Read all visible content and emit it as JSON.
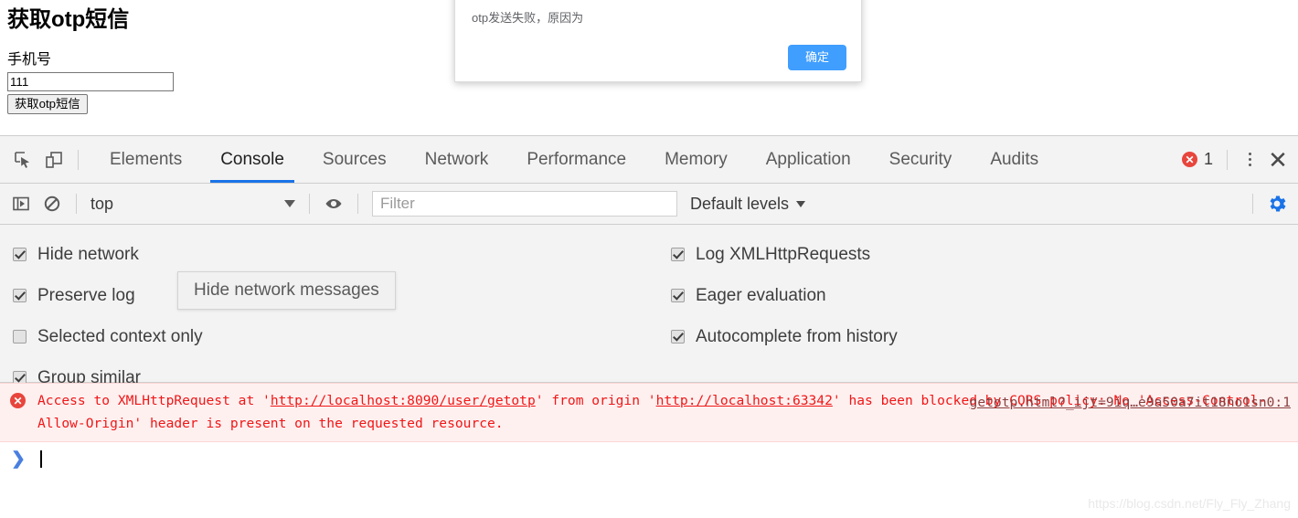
{
  "page": {
    "title": "获取otp短信",
    "phone_label": "手机号",
    "phone_value": "111",
    "phone_placeholder": "",
    "submit_button": "获取otp短信"
  },
  "dialog": {
    "message": "otp发送失败，原因为",
    "confirm_button": "确定",
    "confirm_color": "#409eff"
  },
  "devtools": {
    "tabs": [
      {
        "label": "Elements",
        "active": false
      },
      {
        "label": "Console",
        "active": true
      },
      {
        "label": "Sources",
        "active": false
      },
      {
        "label": "Network",
        "active": false
      },
      {
        "label": "Performance",
        "active": false
      },
      {
        "label": "Memory",
        "active": false
      },
      {
        "label": "Application",
        "active": false
      },
      {
        "label": "Security",
        "active": false
      },
      {
        "label": "Audits",
        "active": false
      }
    ],
    "active_tab": "Console",
    "error_badge": {
      "glyph": "✕",
      "count": "1",
      "color": "#e8453c"
    },
    "close_glyph": "✕",
    "toolbar": {
      "context_value": "top",
      "filter_placeholder": "Filter",
      "filter_value": "",
      "levels_value": "Default levels",
      "settings_active_color": "#1a73e8"
    },
    "settings": {
      "left": [
        {
          "label": "Hide network",
          "checked": true
        },
        {
          "label": "Preserve log",
          "checked": true
        },
        {
          "label": "Selected context only",
          "checked": false
        },
        {
          "label": "Group similar",
          "checked": true
        }
      ],
      "right": [
        {
          "label": "Log XMLHttpRequests",
          "checked": true
        },
        {
          "label": "Eager evaluation",
          "checked": true
        },
        {
          "label": "Autocomplete from history",
          "checked": true
        }
      ],
      "tooltip": "Hide network messages"
    },
    "console": {
      "error": {
        "icon_glyph": "✕",
        "seg_1": "Access to XMLHttpRequest at ",
        "seg_2": "'",
        "url_1": "http://localhost:8090/user/getotp",
        "seg_3": "' from origin ",
        "seg_4": "'",
        "url_2": "http://localhost:63342",
        "seg_5": "' has been blocked by CORS policy: No 'Access-Control-Allow-Origin' header is present on the requested resource.",
        "source_link": "getotp.html?_ijt=9iq…e9a50a7it18no1sn0:1"
      },
      "prompt_chevron": "❯",
      "prompt_value": ""
    }
  },
  "watermark": "https://blog.csdn.net/Fly_Fly_Zhang"
}
